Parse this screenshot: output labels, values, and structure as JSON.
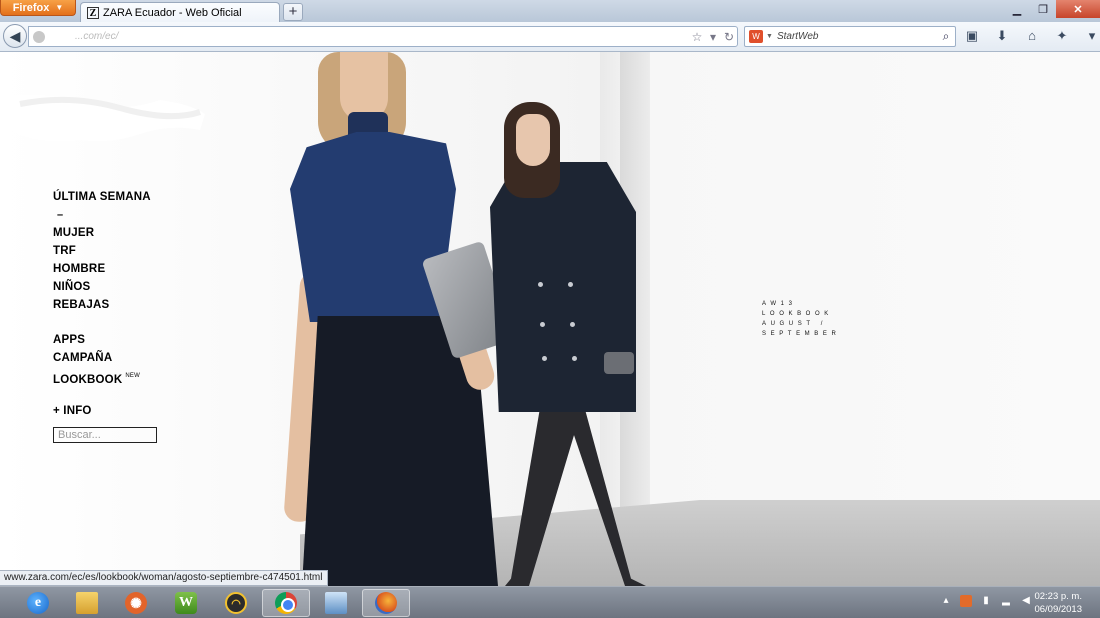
{
  "browser": {
    "menu_button_label": "Firefox",
    "tab_title": "ZARA Ecuador - Web Oficial",
    "tab_favicon": "Z",
    "new_tab_label": "+",
    "url_text": "...com/ec/",
    "search_placeholder": "StartWeb",
    "status_url": "www.zara.com/ec/es/lookbook/woman/agosto-septiembre-c474501.html"
  },
  "nav": {
    "items": [
      {
        "label": "ÚLTIMA SEMANA"
      },
      {
        "label": "–"
      },
      {
        "label": "MUJER"
      },
      {
        "label": "TRF"
      },
      {
        "label": "HOMBRE"
      },
      {
        "label": "NIÑOS"
      },
      {
        "label": "REBAJAS"
      },
      {
        "label": "APPS"
      },
      {
        "label": "CAMPAÑA"
      },
      {
        "label": "LOOKBOOK",
        "badge": "NEW"
      },
      {
        "label": "+ INFO"
      }
    ],
    "search_placeholder": "Buscar..."
  },
  "lookbook": {
    "line1": "AW13",
    "line2": "LOOKBOOK",
    "line3": "AUGUST /",
    "line4": "SEPTEMBER"
  },
  "taskbar": {
    "apps": [
      "internet-explorer",
      "file-explorer",
      "settings",
      "winword",
      "gauge",
      "chrome",
      "remote-desktop",
      "firefox"
    ],
    "time": "02:23 p. m.",
    "date": "06/09/2013"
  },
  "colors": {
    "firefox_orange": "#e3701b",
    "close_red": "#c7442a",
    "top_blue": "#233c70",
    "coat_navy": "#1d2533"
  }
}
